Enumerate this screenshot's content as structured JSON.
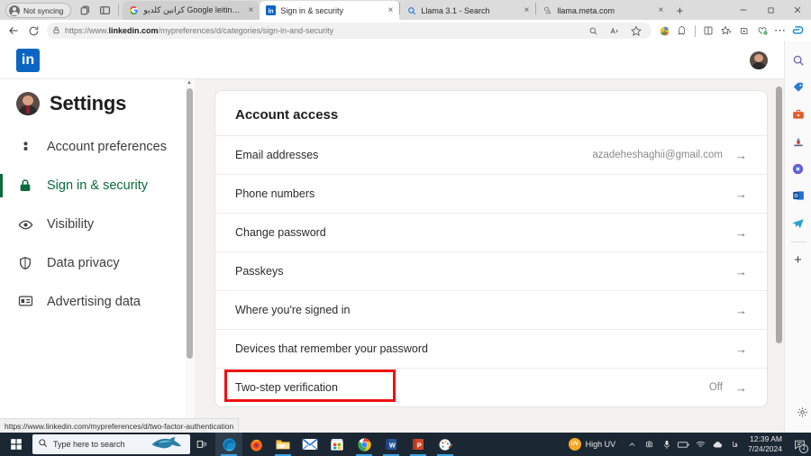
{
  "browser": {
    "sync_label": "Not syncing",
    "tabs": [
      {
        "title": "کرانین کلدیو Google leiting - pro",
        "favicon": "google-icon",
        "active": false
      },
      {
        "title": "Sign in & security",
        "favicon": "linkedin-icon",
        "active": true
      },
      {
        "title": "Llama 3.1 - Search",
        "favicon": "bing-search-icon",
        "active": false
      },
      {
        "title": "llama.meta.com",
        "favicon": "meta-icon",
        "active": false
      }
    ],
    "newtab_label": "+",
    "close_label": "×",
    "window_controls": {
      "minimize": "—",
      "maximize": "❐",
      "close": "✕"
    },
    "address": {
      "url_prefix": "https://www.",
      "url_domain": "linkedin.com",
      "url_path": "/mypreferences/d/categories/sign-in-and-security",
      "full_url": "https://www.linkedin.com/mypreferences/d/categories/sign-in-and-security"
    },
    "status_url": "https://www.linkedin.com/mypreferences/d/two-factor-authentication"
  },
  "linkedin": {
    "logo_text": "in",
    "settings_title": "Settings",
    "nav_items": [
      {
        "label": "Account preferences",
        "icon": "person-icon",
        "active": false
      },
      {
        "label": "Sign in & security",
        "icon": "lock-icon",
        "active": true
      },
      {
        "label": "Visibility",
        "icon": "eye-icon",
        "active": false
      },
      {
        "label": "Data privacy",
        "icon": "shield-icon",
        "active": false
      },
      {
        "label": "Advertising data",
        "icon": "ad-card-icon",
        "active": false
      }
    ],
    "card": {
      "heading": "Account access",
      "rows": [
        {
          "label": "Email addresses",
          "value": "azadeheshaghii@gmail.com",
          "highlight": false
        },
        {
          "label": "Phone numbers",
          "value": "",
          "highlight": false
        },
        {
          "label": "Change password",
          "value": "",
          "highlight": false
        },
        {
          "label": "Passkeys",
          "value": "",
          "highlight": false
        },
        {
          "label": "Where you're signed in",
          "value": "",
          "highlight": false
        },
        {
          "label": "Devices that remember your password",
          "value": "",
          "highlight": false
        },
        {
          "label": "Two-step verification",
          "value": "Off",
          "highlight": true
        }
      ],
      "arrow_glyph": "→"
    },
    "accent_color": "#0b6b3a",
    "brand_color": "#0a66c2",
    "highlight_color": "#ee1111"
  },
  "edge_sidebar": {
    "items": [
      {
        "icon": "search-icon"
      },
      {
        "icon": "shopping-tag-icon"
      },
      {
        "icon": "tools-briefcase-icon"
      },
      {
        "icon": "games-icon"
      },
      {
        "icon": "copilot-icon"
      },
      {
        "icon": "outlook-icon"
      },
      {
        "icon": "telegram-icon"
      }
    ],
    "add_label": "+",
    "settings_icon": "gear-icon"
  },
  "taskbar": {
    "search_placeholder": "Type here to search",
    "apps": [
      {
        "icon": "edge-icon",
        "open": true,
        "active": true
      },
      {
        "icon": "firefox-icon",
        "open": false,
        "active": false
      },
      {
        "icon": "file-explorer-icon",
        "open": true,
        "active": false
      },
      {
        "icon": "mail-icon",
        "open": false,
        "active": false
      },
      {
        "icon": "microsoft-store-icon",
        "open": false,
        "active": false
      },
      {
        "icon": "chrome-icon",
        "open": true,
        "active": false
      },
      {
        "icon": "word-icon",
        "open": true,
        "active": false
      },
      {
        "icon": "powerpoint-icon",
        "open": true,
        "active": false
      },
      {
        "icon": "paint-icon",
        "open": true,
        "active": false
      }
    ],
    "weather_label": "High UV",
    "weather_badge": "UV",
    "time": "12:39 AM",
    "date": "7/24/2024",
    "notification_count": "2"
  }
}
